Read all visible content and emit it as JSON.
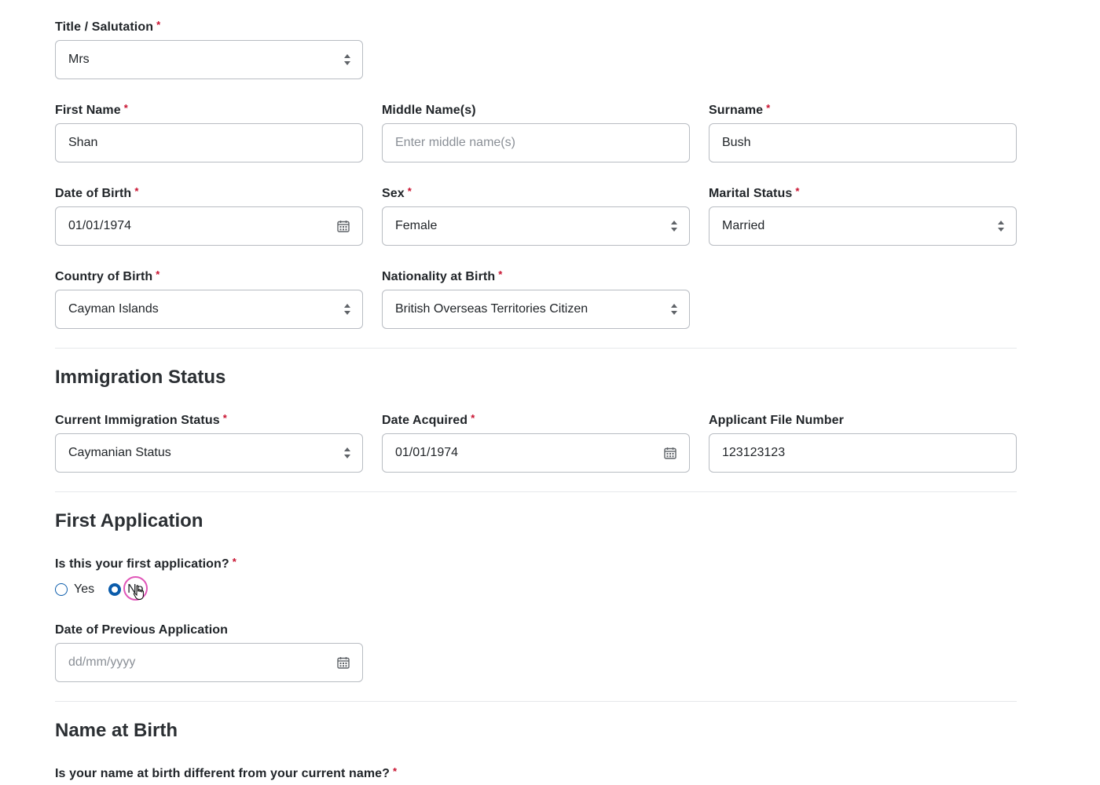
{
  "personal": {
    "title": {
      "label": "Title / Salutation",
      "required": "*",
      "value": "Mrs"
    },
    "first_name": {
      "label": "First Name",
      "required": "*",
      "value": "Shan"
    },
    "middle_name": {
      "label": "Middle Name(s)",
      "placeholder": "Enter middle name(s)",
      "value": ""
    },
    "surname": {
      "label": "Surname",
      "required": "*",
      "value": "Bush"
    },
    "dob": {
      "label": "Date of Birth",
      "required": "*",
      "value": "01/01/1974"
    },
    "sex": {
      "label": "Sex",
      "required": "*",
      "value": "Female"
    },
    "marital_status": {
      "label": "Marital Status",
      "required": "*",
      "value": "Married"
    },
    "country_of_birth": {
      "label": "Country of Birth",
      "required": "*",
      "value": "Cayman Islands"
    },
    "nationality": {
      "label": "Nationality at Birth",
      "required": "*",
      "value": "British Overseas Territories Citizen"
    }
  },
  "immigration": {
    "title": "Immigration Status",
    "current_status": {
      "label": "Current Immigration Status",
      "required": "*",
      "value": "Caymanian Status"
    },
    "date_acquired": {
      "label": "Date Acquired",
      "required": "*",
      "value": "01/01/1974"
    },
    "file_number": {
      "label": "Applicant File Number",
      "value": "123123123"
    }
  },
  "first_application": {
    "title": "First Application",
    "question": {
      "label": "Is this your first application?",
      "required": "*"
    },
    "options": [
      {
        "label": "Yes",
        "checked": false
      },
      {
        "label": "No",
        "checked": true
      }
    ],
    "previous_date": {
      "label": "Date of Previous Application",
      "placeholder": "dd/mm/yyyy",
      "value": ""
    }
  },
  "name_at_birth": {
    "title": "Name at Birth",
    "question": {
      "label": "Is your name at birth different from your current name?",
      "required": "*"
    }
  },
  "colors": {
    "accent": "#0b5cab",
    "required": "#c8102e",
    "border": "#b8bcc2",
    "cursor_ring": "#e056b8"
  }
}
